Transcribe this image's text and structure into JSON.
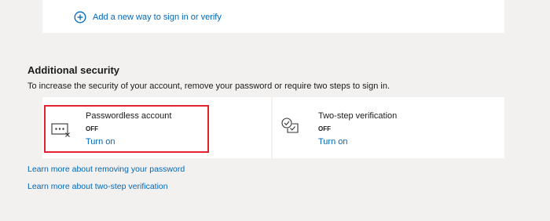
{
  "add_way": {
    "label": "Add a new way to sign in or verify",
    "icon": "plus-circle-icon"
  },
  "additional_security": {
    "title": "Additional security",
    "description": "To increase the security of your account, remove your password or require two steps to sign in.",
    "cards": [
      {
        "title": "Passwordless account",
        "status": "OFF",
        "action": "Turn on",
        "icon": "password-field-off-icon"
      },
      {
        "title": "Two-step verification",
        "status": "OFF",
        "action": "Turn on",
        "icon": "two-step-check-icon"
      }
    ]
  },
  "learn_more": {
    "remove_password": "Learn more about removing your password",
    "two_step": "Learn more about two-step verification"
  },
  "colors": {
    "link": "#0067b8",
    "highlight": "#e3212f",
    "background": "#f2f1f0",
    "card": "#ffffff"
  }
}
